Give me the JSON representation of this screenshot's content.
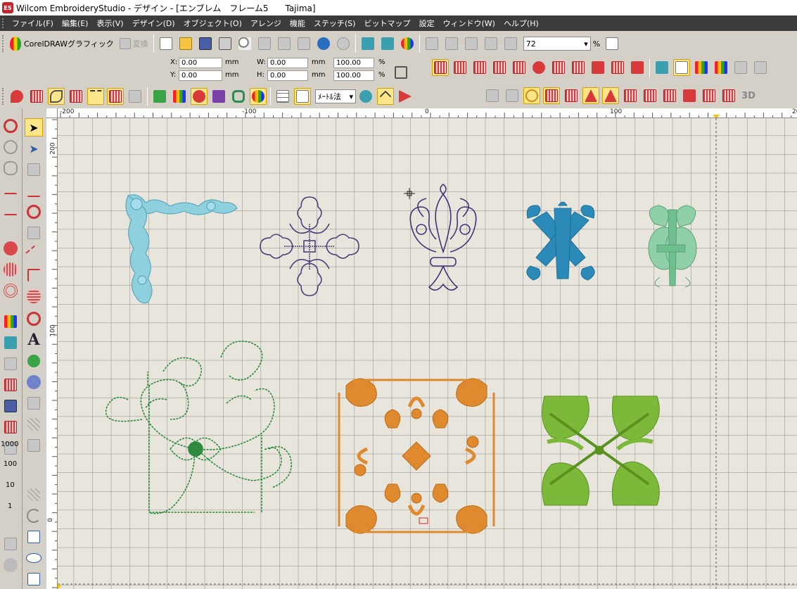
{
  "window": {
    "title": "Wilcom EmbroideryStudio - デザイン - [エンブレム　フレーム5　　Tajima]"
  },
  "app_icon_text": "ES",
  "menu": [
    "ファイル(F)",
    "編集(E)",
    "表示(V)",
    "デザイン(D)",
    "オブジェクト(O)",
    "アレンジ",
    "機能",
    "ステッチ(S)",
    "ビットマップ",
    "設定",
    "ウィンドウ(W)",
    "ヘルプ(H)"
  ],
  "toolbar": {
    "corel_label": "CorelDRAWグラフィック",
    "convert_label": "変換",
    "zoom_value": "72",
    "zoom_unit": "%",
    "measure_label": "ﾒｰﾄﾙ法"
  },
  "props": {
    "x_label": "X:",
    "x_value": "0.00",
    "x_unit": "mm",
    "y_label": "Y:",
    "y_value": "0.00",
    "y_unit": "mm",
    "w_label": "W:",
    "w_value": "0.00",
    "w_unit": "mm",
    "w_pct": "100.00",
    "w_pct_unit": "%",
    "h_label": "H:",
    "h_value": "0.00",
    "h_unit": "mm",
    "h_pct": "100.00",
    "h_pct_unit": "%"
  },
  "left_labels": [
    "1000",
    "100",
    "10",
    "1"
  ],
  "ruler": {
    "top": [
      "-200",
      "-100",
      "0",
      "100",
      "200"
    ],
    "left": [
      "200",
      "100",
      "0"
    ]
  },
  "colors": {
    "menubar": "#3b3b3b",
    "canvas": "#e8e6dc",
    "corner_blue": "#7fc6d6",
    "cross_navy": "#4a3f7a",
    "monogram_blue": "#2b8ab8",
    "monogram_mint": "#7ec49a",
    "vine_green": "#2d8a3e",
    "tile_orange": "#e08a30",
    "leaf_green": "#7cb83a"
  },
  "designs": [
    "corner-ornament",
    "flower-cross",
    "fleur-de-lis",
    "monogram-blue",
    "monogram-mint",
    "vine-frame",
    "baroque-tile",
    "leaf-tile"
  ]
}
